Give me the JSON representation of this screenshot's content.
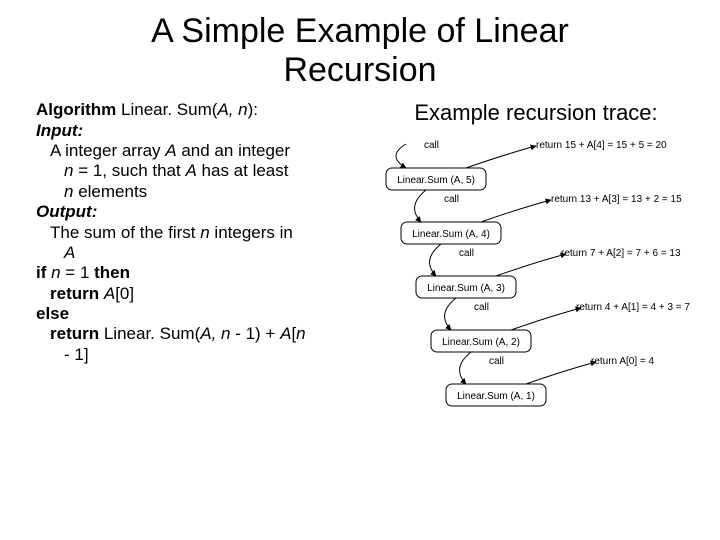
{
  "title_line1": "A Simple Example of Linear",
  "title_line2": "Recursion",
  "algorithm": {
    "head_prefix": "Algorithm",
    "head_name": " Linear. Sum(",
    "head_name2": "A, n",
    "head_suffix": "):",
    "input_label": "Input:",
    "input_l1a": "A integer array ",
    "input_l1b": "A",
    "input_l1c": " and an integer",
    "input_l2a": "n",
    "input_l2b": " = 1, such that ",
    "input_l2c": "A",
    "input_l2d": " has at least",
    "input_l3a": "n",
    "input_l3b": " elements",
    "output_label": "Output:",
    "output_l1a": "The sum of the first ",
    "output_l1b": "n",
    "output_l1c": " integers in",
    "output_l2": "A",
    "if_a": "if ",
    "if_b": "n",
    "if_c": " = 1 ",
    "if_d": "then",
    "ret1_a": "return ",
    "ret1_b": "A",
    "ret1_c": "[0]",
    "else": "else",
    "ret2_a": "return",
    "ret2_b": " Linear. Sum(",
    "ret2_c": "A, n",
    "ret2_d": " - 1) + ",
    "ret2_e": "A",
    "ret2_f": "[",
    "ret2_g": "n",
    "ret2_h": " - 1]"
  },
  "trace_title": "Example recursion trace:",
  "trace": {
    "call": "call",
    "box1": "Linear.Sum (A, 5)",
    "box2": "Linear.Sum (A, 4)",
    "box3": "Linear.Sum (A, 3)",
    "box4": "Linear.Sum (A, 2)",
    "box5": "Linear.Sum (A, 1)",
    "ret1": "return 15 + A[4] = 15 + 5 = 20",
    "ret2": "return 13 + A[3] = 13 + 2 = 15",
    "ret3": "return 7 + A[2] = 7 + 6 = 13",
    "ret4": "return 4 + A[1] = 4 + 3 = 7",
    "ret5": "return A[0] = 4"
  }
}
